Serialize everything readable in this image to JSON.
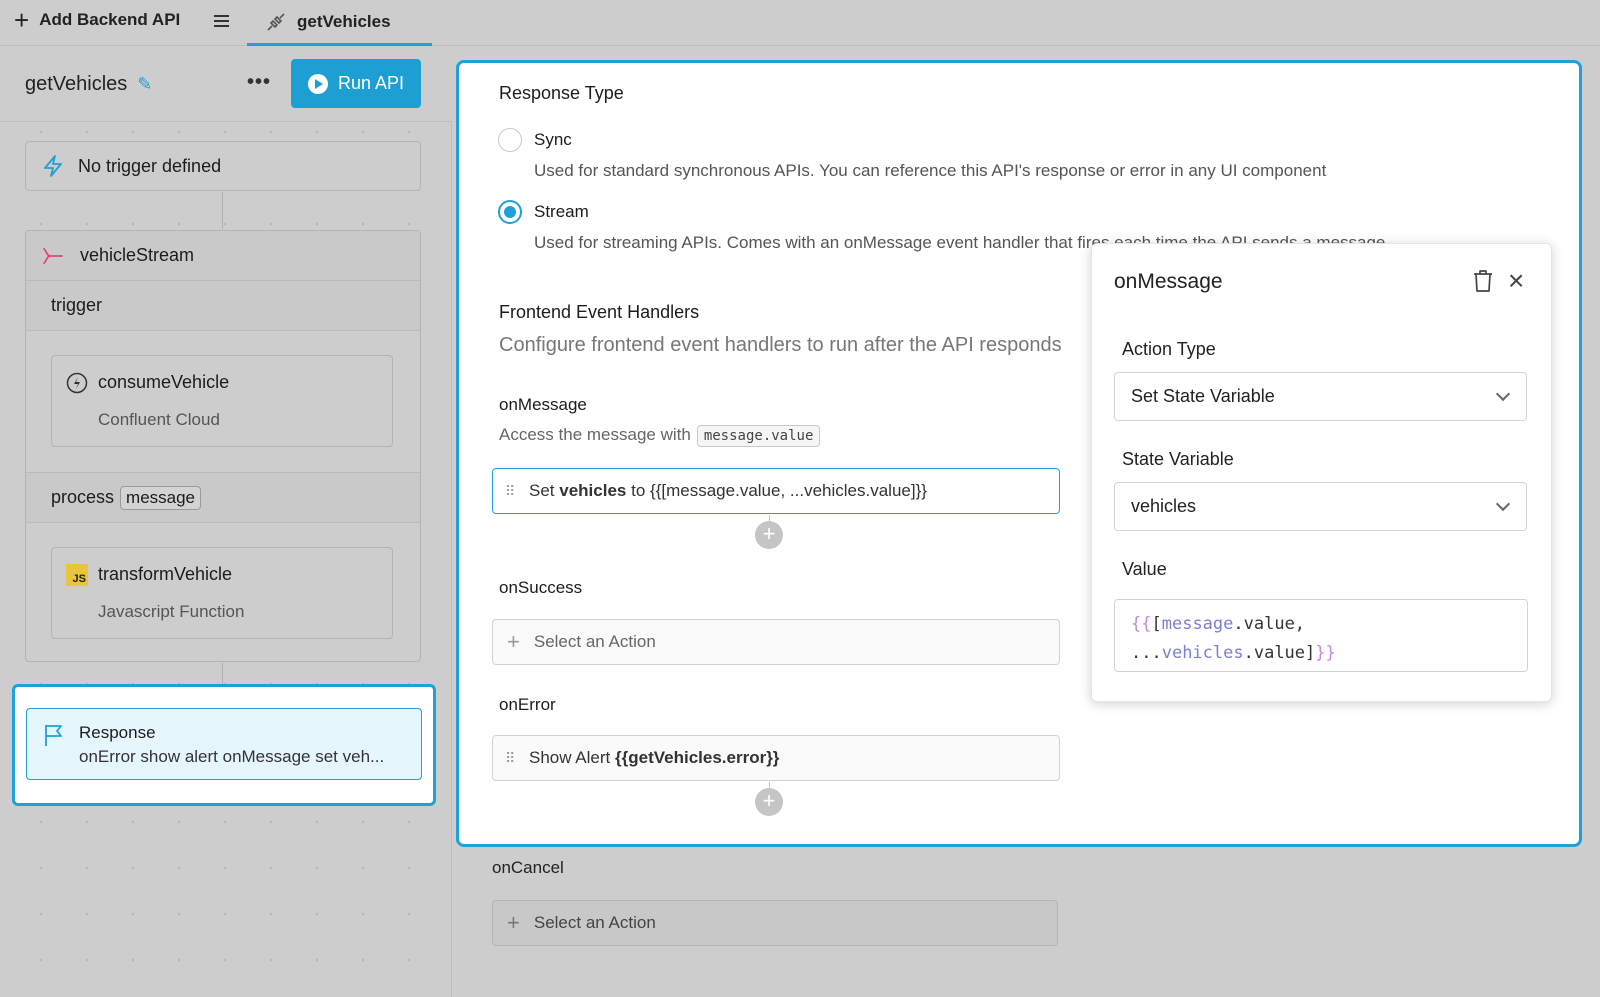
{
  "topbar": {
    "add_backend_api": "Add Backend API",
    "active_tab": "getVehicles"
  },
  "left": {
    "api_name": "getVehicles",
    "more": "•••",
    "run_api": "Run API",
    "trigger": "No trigger defined",
    "stream_name": "vehicleStream",
    "trigger_section": "trigger",
    "consume_step": {
      "title": "consumeVehicle",
      "subtitle": "Confluent Cloud"
    },
    "process_section": "process",
    "process_tag": "message",
    "transform_step": {
      "title": "transformVehicle",
      "subtitle": "Javascript Function",
      "icon_text": "JS"
    },
    "response": {
      "title": "Response",
      "subtitle": "onError show alert onMessage set veh..."
    }
  },
  "main": {
    "response_type_label": "Response Type",
    "sync_label": "Sync",
    "sync_desc": "Used for standard synchronous APIs. You can reference this API's response or error in any UI component",
    "stream_label": "Stream",
    "stream_desc": "Used for streaming APIs. Comes with an onMessage event handler that fires each time the API sends a message",
    "selected_type": "Stream",
    "handlers_label": "Frontend Event Handlers",
    "handlers_desc": "Configure frontend event handlers to run after the API responds",
    "on_message": {
      "label": "onMessage",
      "desc": "Access the message with",
      "code": "message.value",
      "action_prefix": "Set",
      "action_var": "vehicles",
      "action_mid": "to",
      "action_value": "{{[message.value, ...vehicles.value]}}"
    },
    "on_success": {
      "label": "onSuccess",
      "placeholder": "Select an Action"
    },
    "on_error": {
      "label": "onError",
      "action_prefix": "Show Alert",
      "action_value": "{{getVehicles.error}}"
    },
    "on_cancel": {
      "label": "onCancel",
      "placeholder": "Select an Action"
    }
  },
  "popover": {
    "title": "onMessage",
    "action_type_label": "Action Type",
    "action_type_value": "Set State Variable",
    "state_variable_label": "State Variable",
    "state_variable_value": "vehicles",
    "value_label": "Value",
    "value_code": {
      "open": "{{",
      "bracket_open": "[",
      "var1": "message",
      "prop1": ".value,",
      "spread": "...",
      "var2": "vehicles",
      "prop2": ".value",
      "bracket_close": "]",
      "close": "}}"
    }
  },
  "colors": {
    "accent": "#1fa0d8",
    "stream_icon": "#e0457b",
    "js": "#e8c53a"
  }
}
